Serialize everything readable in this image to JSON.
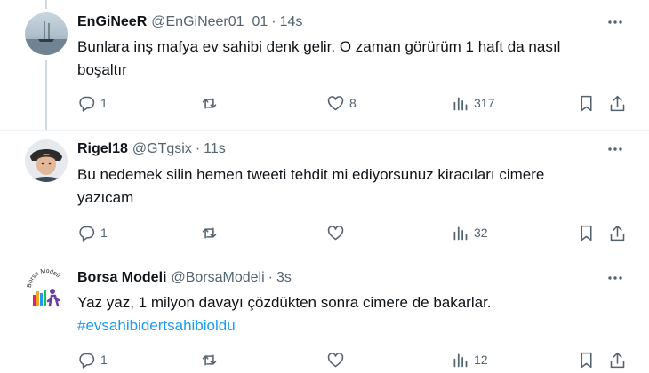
{
  "tweets": [
    {
      "name": "EnGiNeeR",
      "handle": "@EnGiNeer01_01",
      "time": "14s",
      "lines": [
        "Bunlara inş mafya ev sahibi denk gelir. O zaman görürüm 1 haft da nasıl",
        "boşaltır"
      ],
      "replies": "1",
      "retweets": "",
      "likes": "8",
      "views": "317"
    },
    {
      "name": "Rigel18",
      "handle": "@GTgsix",
      "time": "11s",
      "lines": [
        "Bu nedemek silin hemen tweeti tehdit mi ediyorsunuz kiracıları cimere",
        "yazıcam"
      ],
      "replies": "1",
      "retweets": "",
      "likes": "",
      "views": "32"
    },
    {
      "name": "Borsa Modeli",
      "handle": "@BorsaModeli",
      "time": "3s",
      "lines": [
        "Yaz yaz, 1 milyon davayı çözdükten sonra cimere de bakarlar."
      ],
      "hashtag": "#evsahibidertsahibioldu",
      "replies": "1",
      "retweets": "",
      "likes": "",
      "views": "12",
      "avatar_text": "Borsa Modeli"
    }
  ],
  "separator": "·",
  "colors": {
    "text": "#0f1419",
    "muted": "#536471",
    "link": "#1d9bf0",
    "line": "#cfd9de",
    "divider": "#eff3f4"
  },
  "icons": [
    "more-icon",
    "reply-icon",
    "retweet-icon",
    "like-icon",
    "views-icon",
    "bookmark-icon",
    "share-icon"
  ]
}
